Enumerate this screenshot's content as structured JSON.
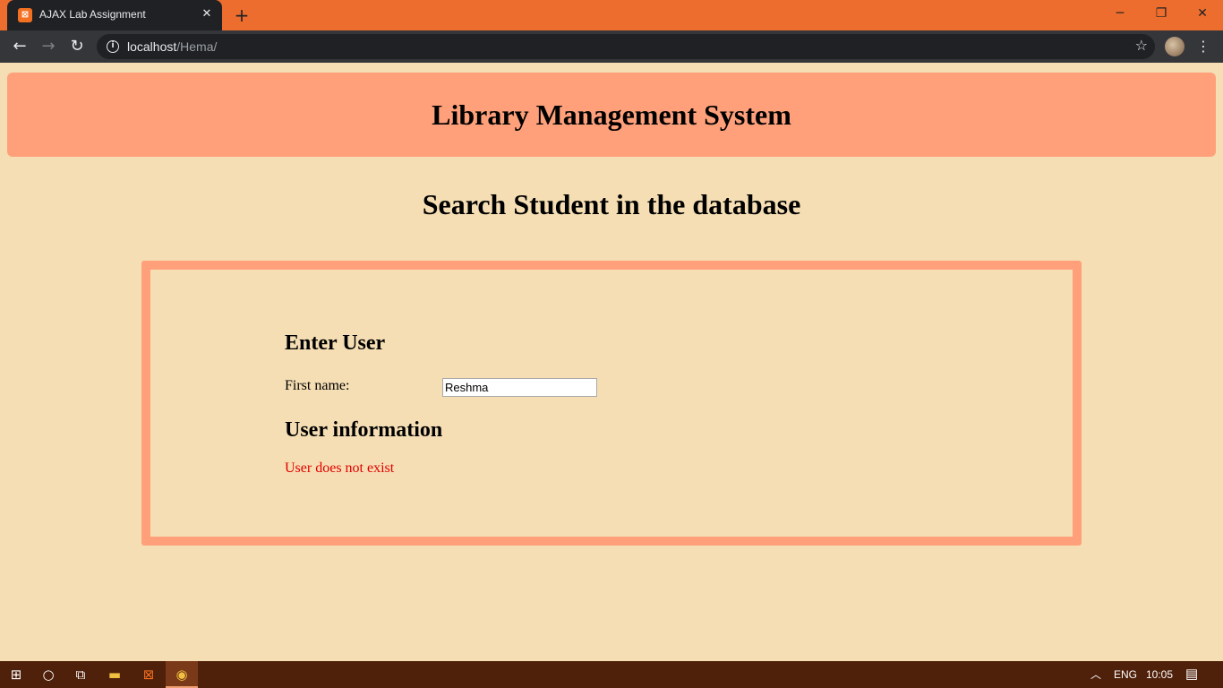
{
  "browser": {
    "tab_title": "AJAX Lab Assignment",
    "url_host": "localhost",
    "url_path": "/Hema/",
    "tab_favicon": "xampp-icon",
    "new_tab_symbol": "+",
    "close_symbol": "✕"
  },
  "page": {
    "header_title": "Library Management System",
    "subtitle": "Search Student in the database",
    "panel": {
      "enter_heading": "Enter User",
      "first_name_label": "First name:",
      "first_name_value": "Reshma",
      "info_heading": "User information",
      "result_text": "User does not exist"
    }
  },
  "taskbar": {
    "language": "ENG",
    "time": "10:05"
  },
  "colors": {
    "tabstrip": "#ed6d2f",
    "page_bg": "#f5deb3",
    "accent": "#ffa07a",
    "error": "#e30000"
  }
}
